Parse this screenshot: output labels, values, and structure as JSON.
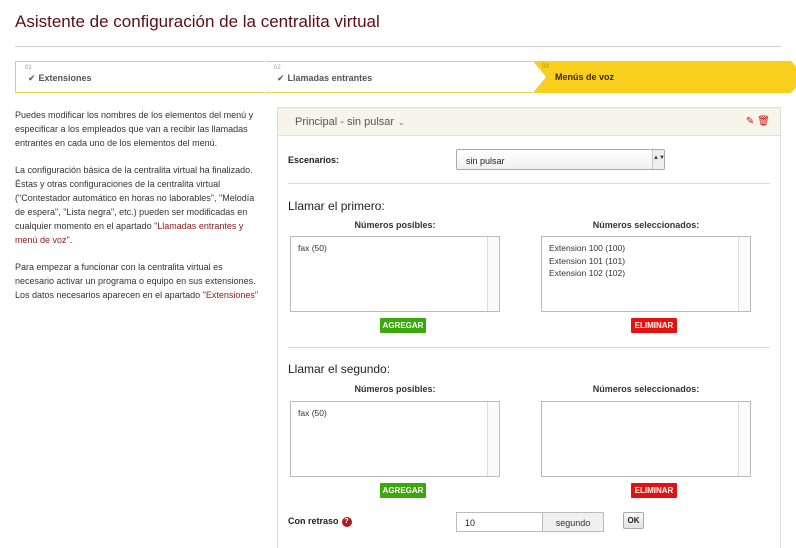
{
  "page": {
    "title": "Asistente de configuración de la centralita virtual"
  },
  "steps": [
    {
      "num": "01",
      "label": "Extensiones",
      "done": true
    },
    {
      "num": "02",
      "label": "Llamadas entrantes",
      "done": true
    },
    {
      "num": "03",
      "label": "Menús de voz",
      "done": false
    }
  ],
  "description": {
    "p1": "Puedes modificar los nombres de los elementos del menú y especificar a los empleados que van a recibir las llamadas entrantes en cada uno de los elementos del menú.",
    "p2_text": "La configuración básica de la centralita virtual ha finalizado. Éstas y otras configuraciones de la centralita virtual (\"Contestador automático en horas no laborables\", \"Melodía de espera\", \"Lista negra\", etc.) pueden ser modificadas en cualquier momento en el apartado ",
    "p2_link": "\"Llamadas entrantes y menú de voz\"",
    "p2_end": ".",
    "p3_text": "Para empezar a funcionar con la centralita virtual es necesario activar un programa o equipo en sus extensiones. Los datos necesarios aparecen en el apartado ",
    "p3_link": "\"Extensiones\""
  },
  "panel": {
    "title": "Principal - sin pulsar",
    "chevron": "⌄",
    "edit_icon": "✎",
    "delete_icon": "🗑",
    "scenarios_label": "Escenarios:",
    "scenarios_value": "sin pulsar",
    "caret": "▲▼",
    "col_possible": "Números posibles:",
    "col_selected": "Números seleccionados:",
    "add_label": "AGREGAR",
    "remove_label": "ELIMINAR",
    "first": {
      "title": "Llamar el primero:",
      "possible": [
        "fax (50)"
      ],
      "selected": [
        "Extension 100 (100)",
        "Extension 101 (101)",
        "Extension 102 (102)"
      ]
    },
    "second": {
      "title": "Llamar el segundo:",
      "possible": [
        "fax (50)"
      ],
      "selected": []
    },
    "delay": {
      "label": "Con retraso",
      "help": "?",
      "value": "10",
      "unit": "segundo",
      "ok": "OK"
    }
  }
}
